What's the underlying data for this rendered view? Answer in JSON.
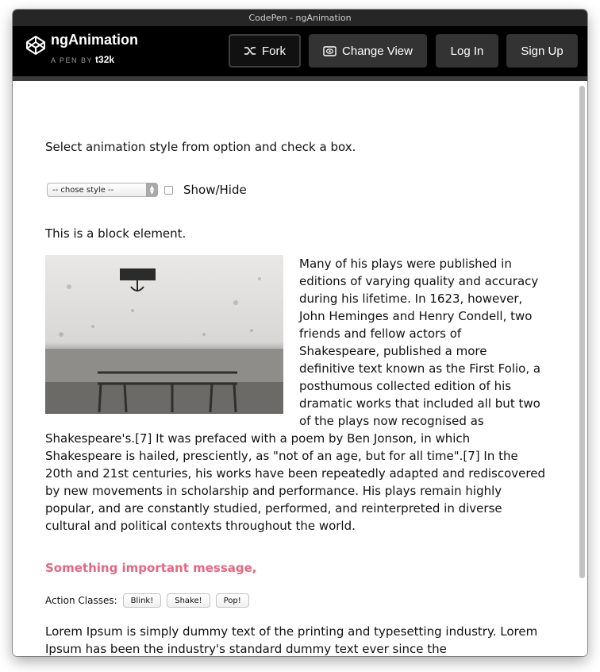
{
  "window": {
    "title": "CodePen - ngAnimation"
  },
  "header": {
    "app_name": "ngAnimation",
    "byline_prefix": "A PEN BY",
    "author": "t32k",
    "buttons": {
      "fork": "Fork",
      "change_view": "Change View",
      "log_in": "Log In",
      "sign_up": "Sign Up"
    }
  },
  "content": {
    "intro": "Select animation style from option and check a box.",
    "select": {
      "value": "-- chose style --"
    },
    "checkbox_label": "Show/Hide",
    "block_label": "This is a block element.",
    "paragraph": "Many of his plays were published in editions of varying quality and accuracy during his lifetime. In 1623, however, John Heminges and Henry Condell, two friends and fellow actors of Shakespeare, published a more definitive text known as the First Folio, a posthumous collected edition of his dramatic works that included all but two of the plays now recognised as Shakespeare's.[7] It was prefaced with a poem by Ben Jonson, in which Shakespeare is hailed, presciently, as \"not of an age, but for all time\".[7] In the 20th and 21st centuries, his works have been repeatedly adapted and rediscovered by new movements in scholarship and performance. His plays remain highly popular, and are constantly studied, performed, and reinterpreted in diverse cultural and political contexts throughout the world.",
    "important_message": "Something important message,",
    "action_classes_label": "Action Classes:",
    "action_buttons": [
      "Blink!",
      "Shake!",
      "Pop!"
    ],
    "lorem": "Lorem Ipsum is simply dummy text of the printing and typesetting industry. Lorem Ipsum has been the industry's standard dummy text ever since the"
  },
  "colors": {
    "accent_pink": "#e8677f",
    "header_bg": "#000000",
    "button_bg": "#333333"
  },
  "icons": {
    "logo": "codepen-cube-icon",
    "fork": "fork-icon",
    "change_view": "eye-icon"
  }
}
